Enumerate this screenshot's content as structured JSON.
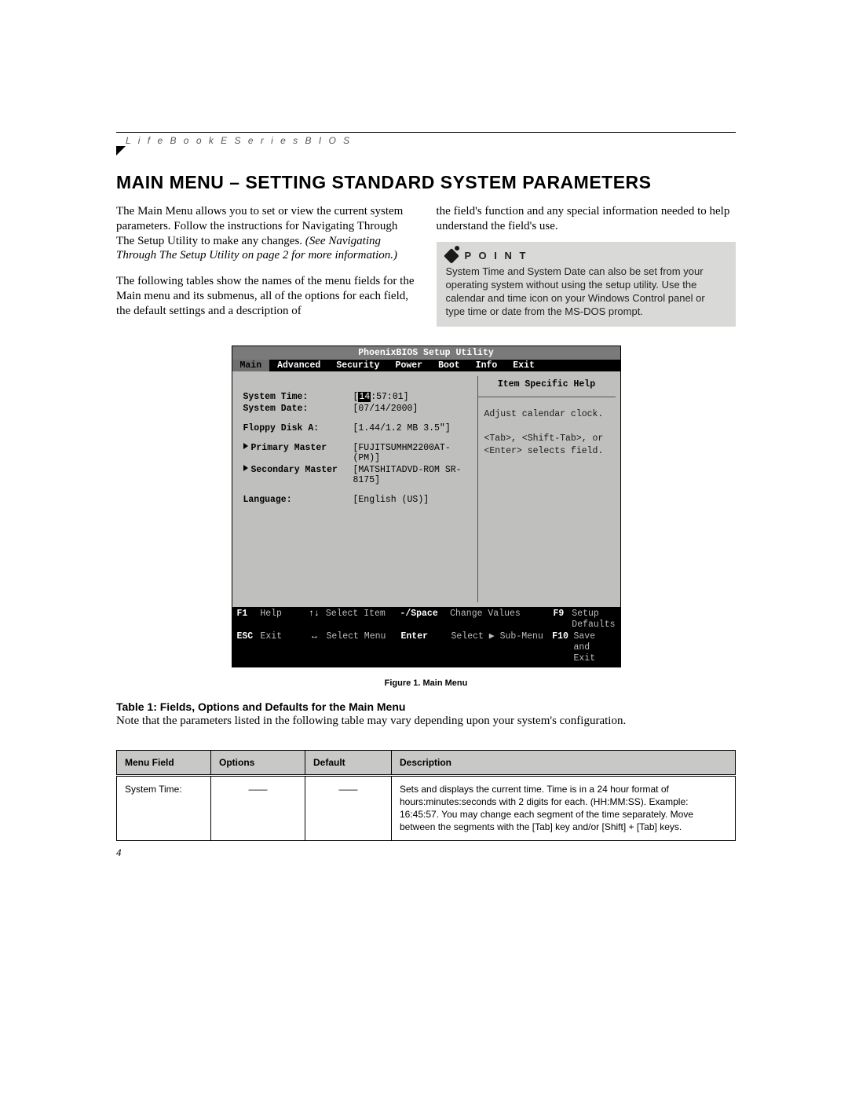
{
  "header": {
    "running_title": "L i f e B o o k   E   S e r i e s   B I O S"
  },
  "title": "MAIN MENU – SETTING STANDARD SYSTEM PARAMETERS",
  "left_col": {
    "p1": "The Main Menu allows you to set or view the current system parameters. Follow the instructions for Navi­gating Through The Setup Utility to make any changes.",
    "p1_ital": "(See Navigating Through The Setup Utility on page 2 for more information.)",
    "p2": "The following tables show the names of the menu fields for the Main menu and its submenus, all of the options for each field, the default settings and a description of"
  },
  "right_col": {
    "p1": "the field's function and any special information needed to help understand the field's use."
  },
  "point": {
    "label": "P O I N T",
    "body": "System Time and System Date can also be set from your operating system without using the setup utility. Use the calendar and time icon on your Windows Control panel or type time or date from the MS-DOS prompt."
  },
  "bios": {
    "title": "PhoenixBIOS Setup Utility",
    "tabs": [
      "Main",
      "Advanced",
      "Security",
      "Power",
      "Boot",
      "Info",
      "Exit"
    ],
    "fields": [
      {
        "label": "System Time:",
        "value": "[14:57:01]",
        "hl": true
      },
      {
        "label": "System Date:",
        "value": "[07/14/2000]"
      },
      {
        "spacer": true
      },
      {
        "label": "Floppy Disk A:",
        "value": "[1.44/1.2 MB 3.5\"]"
      },
      {
        "spacer": true
      },
      {
        "label": "Primary Master",
        "value": "[FUJITSUMHM2200AT-(PM)]",
        "submenu": true
      },
      {
        "label": "Secondary Master",
        "value": "[MATSHITADVD-ROM SR-8175]",
        "submenu": true
      },
      {
        "spacer": true
      },
      {
        "label": "Language:",
        "value": "[English (US)]"
      }
    ],
    "help_title": "Item Specific Help",
    "help_lines": [
      "Adjust calendar clock.",
      "",
      "<Tab>, <Shift-Tab>, or",
      "<Enter> selects field."
    ],
    "footer": {
      "row1": {
        "k1": "F1",
        "l1": "Help",
        "arr1": "↑↓",
        "al1": "Select Item",
        "ac1": "-/Space",
        "ad1": "Change Values",
        "fk": "F9",
        "fl": "Setup Defaults"
      },
      "row2": {
        "k1": "ESC",
        "l1": "Exit",
        "arr1": "↔",
        "al1": "Select Menu",
        "ac1": "Enter",
        "ad1": "Select ▶ Sub-Menu",
        "fk": "F10",
        "fl": "Save and Exit"
      }
    }
  },
  "figure_caption": "Figure 1.  Main Menu",
  "table": {
    "title": "Table 1: Fields, Options and Defaults for the Main Menu",
    "note": "Note that the parameters listed in the following table may vary depending upon your system's configuration.",
    "headers": [
      "Menu Field",
      "Options",
      "Default",
      "Description"
    ],
    "rows": [
      {
        "field": "System Time:",
        "options": "——",
        "default": "——",
        "desc": "Sets and displays the current time. Time is in a 24 hour format of hours:minutes:seconds with 2 digits for each. (HH:MM:SS). Example: 16:45:57. You may change each segment of the time separately. Move between the segments with the [Tab] key and/or [Shift] + [Tab] keys."
      }
    ]
  },
  "page_number": "4"
}
